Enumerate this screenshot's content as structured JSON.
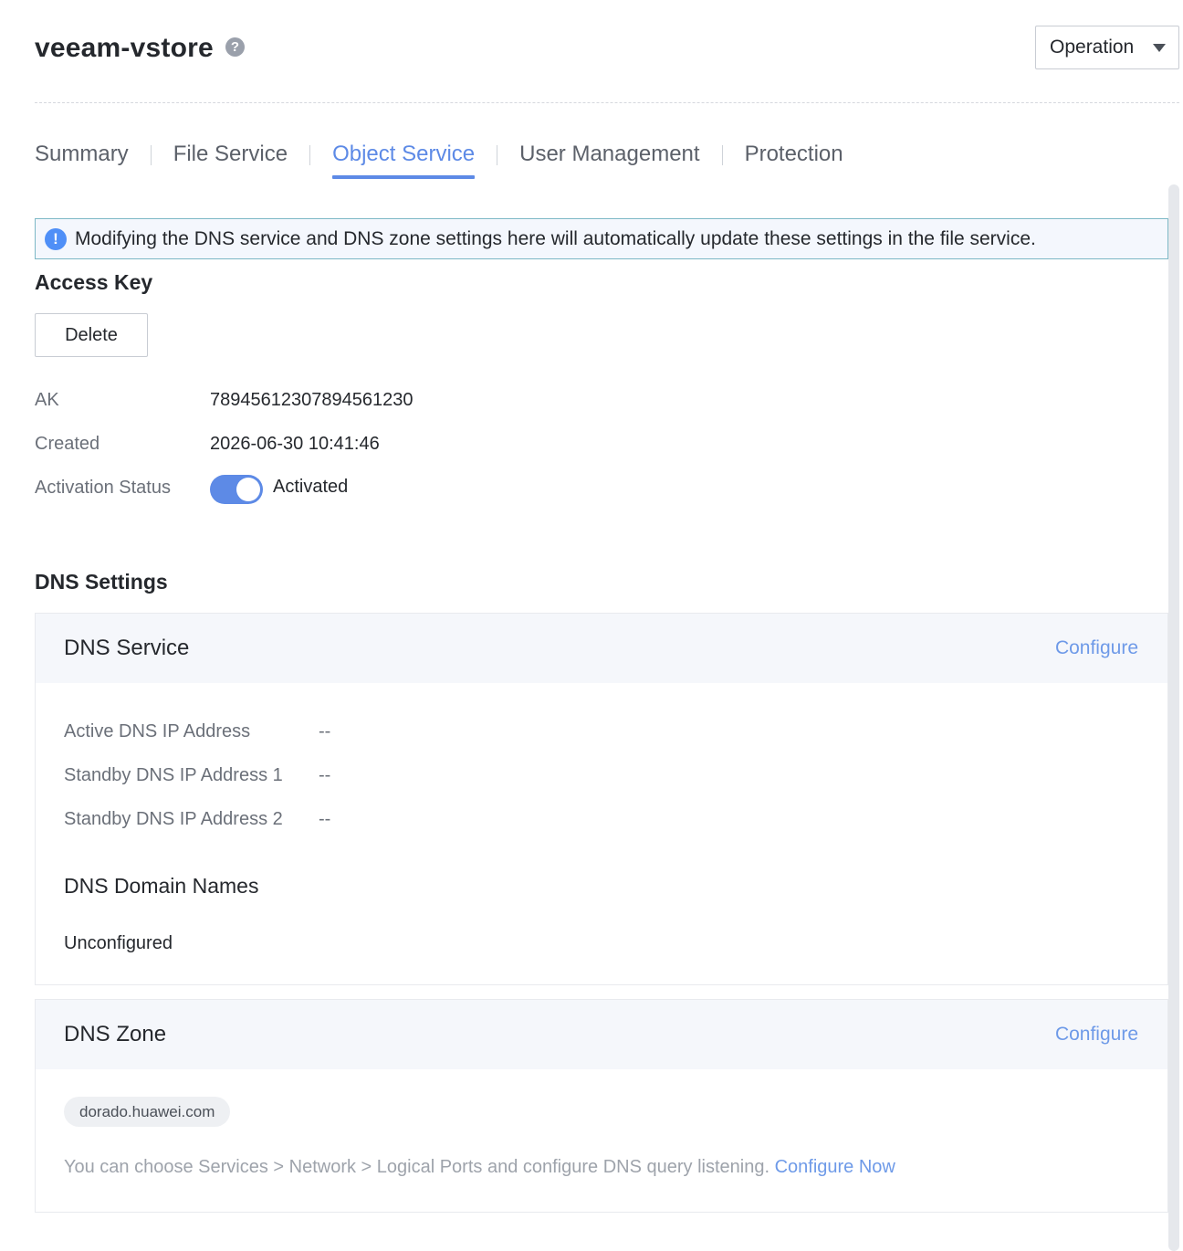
{
  "header": {
    "title": "veeam-vstore",
    "help_glyph": "?",
    "operation_label": "Operation"
  },
  "tabs": [
    {
      "label": "Summary",
      "active": false
    },
    {
      "label": "File Service",
      "active": false
    },
    {
      "label": "Object Service",
      "active": true
    },
    {
      "label": "User Management",
      "active": false
    },
    {
      "label": "Protection",
      "active": false
    }
  ],
  "notice": {
    "icon_glyph": "!",
    "text": "Modifying the DNS service and DNS zone settings here will automatically update these settings in the file service."
  },
  "access_key": {
    "title": "Access Key",
    "delete_label": "Delete",
    "ak_label": "AK",
    "ak_value": "78945612307894561230",
    "created_label": "Created",
    "created_value": "2026-06-30 10:41:46",
    "status_label": "Activation Status",
    "status_value": "Activated",
    "status_on": true
  },
  "dns_settings": {
    "title": "DNS Settings",
    "service": {
      "title": "DNS Service",
      "configure_label": "Configure",
      "active_label": "Active DNS IP Address",
      "active_value": "--",
      "standby1_label": "Standby DNS IP Address 1",
      "standby1_value": "--",
      "standby2_label": "Standby DNS IP Address 2",
      "standby2_value": "--",
      "domain_names_title": "DNS Domain Names",
      "domain_names_value": "Unconfigured"
    },
    "zone": {
      "title": "DNS Zone",
      "configure_label": "Configure",
      "zone_chip": "dorado.huawei.com",
      "hint_text": "You can choose Services > Network > Logical Ports and configure DNS query listening. ",
      "hint_link": "Configure Now"
    }
  },
  "colors": {
    "accent": "#5d8ae6",
    "link": "#6e9ae8",
    "notice_border": "#7db8c6",
    "info_icon": "#4f8ff7"
  },
  "icons": {
    "help": "help-circle-icon",
    "dropdown": "caret-down-icon",
    "info": "info-circle-icon"
  }
}
